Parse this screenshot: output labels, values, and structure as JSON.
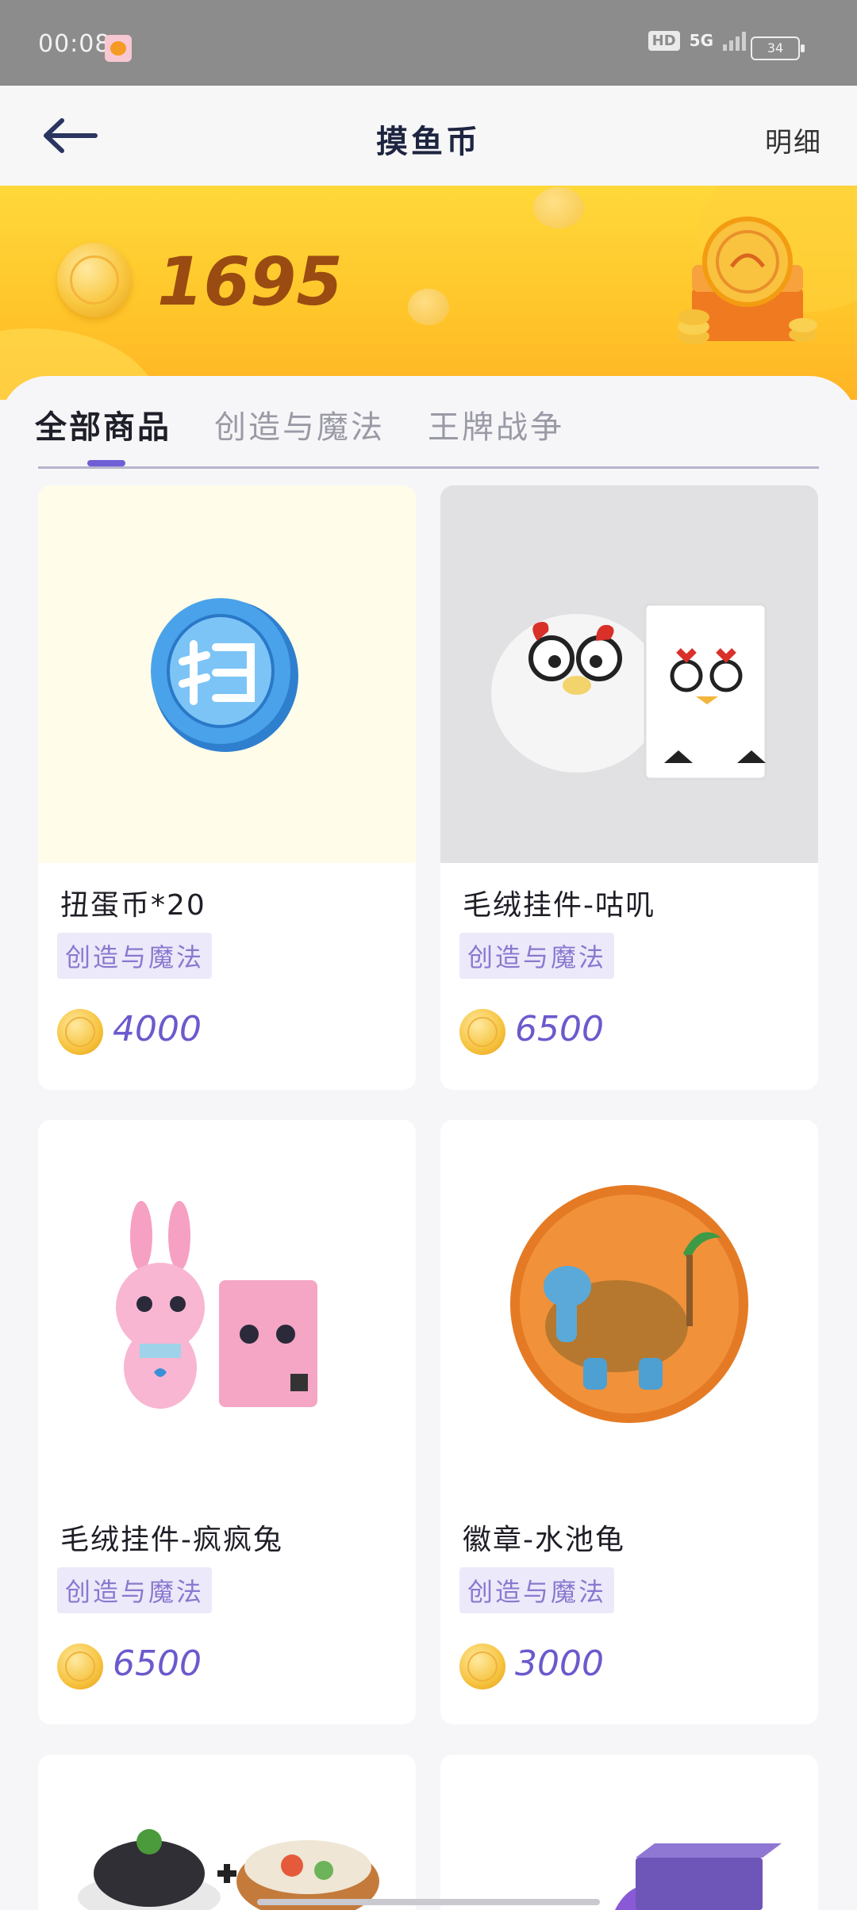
{
  "status": {
    "time": "00:08",
    "hd": "HD",
    "network": "5G",
    "battery": "34"
  },
  "header": {
    "title": "摸鱼币",
    "detail_label": "明细"
  },
  "balance": {
    "amount": "1695"
  },
  "tabs": [
    {
      "label": "全部商品",
      "active": true
    },
    {
      "label": "创造与魔法",
      "active": false
    },
    {
      "label": "王牌战争",
      "active": false
    }
  ],
  "products": [
    {
      "name": "扭蛋币*20",
      "tag": "创造与魔法",
      "price": "4000",
      "image_icon": "blue-coin-icon"
    },
    {
      "name": "毛绒挂件-咕叽",
      "tag": "创造与魔法",
      "price": "6500",
      "image_icon": "chick-plush-icon"
    },
    {
      "name": "毛绒挂件-疯疯兔",
      "tag": "创造与魔法",
      "price": "6500",
      "image_icon": "bunny-plush-icon"
    },
    {
      "name": "徽章-水池龟",
      "tag": "创造与魔法",
      "price": "3000",
      "image_icon": "badge-icon"
    }
  ],
  "colors": {
    "accent": "#6f5fd6",
    "banner": "#ffc52a",
    "price": "#6a5acd",
    "tag_bg": "#ece9fa"
  }
}
